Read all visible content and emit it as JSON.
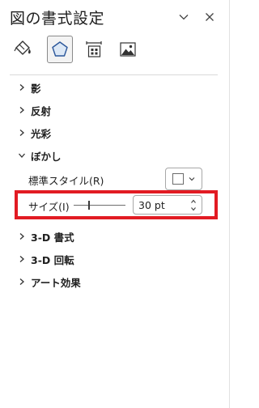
{
  "pane": {
    "title": "図の書式設定"
  },
  "tabs": [
    {
      "name": "fill-line",
      "icon": "paint-bucket-icon",
      "active": false
    },
    {
      "name": "effects",
      "icon": "pentagon-icon",
      "active": true
    },
    {
      "name": "size-properties",
      "icon": "size-properties-icon",
      "active": false
    },
    {
      "name": "picture",
      "icon": "picture-icon",
      "active": false
    }
  ],
  "sections": {
    "shadow": "影",
    "reflection": "反射",
    "glow": "光彩",
    "soft_edges": "ぼかし",
    "bevel_3d": "3-D 書式",
    "rotation_3d": "3-D 回転",
    "artistic": "アート効果"
  },
  "soft_edges": {
    "preset_label": "標準スタイル(R)",
    "size_label": "サイズ(I)",
    "size_value": "30 pt",
    "slider_fraction": 0.3
  },
  "colors": {
    "highlight": "#e21b23",
    "accent": "#2b579a"
  }
}
